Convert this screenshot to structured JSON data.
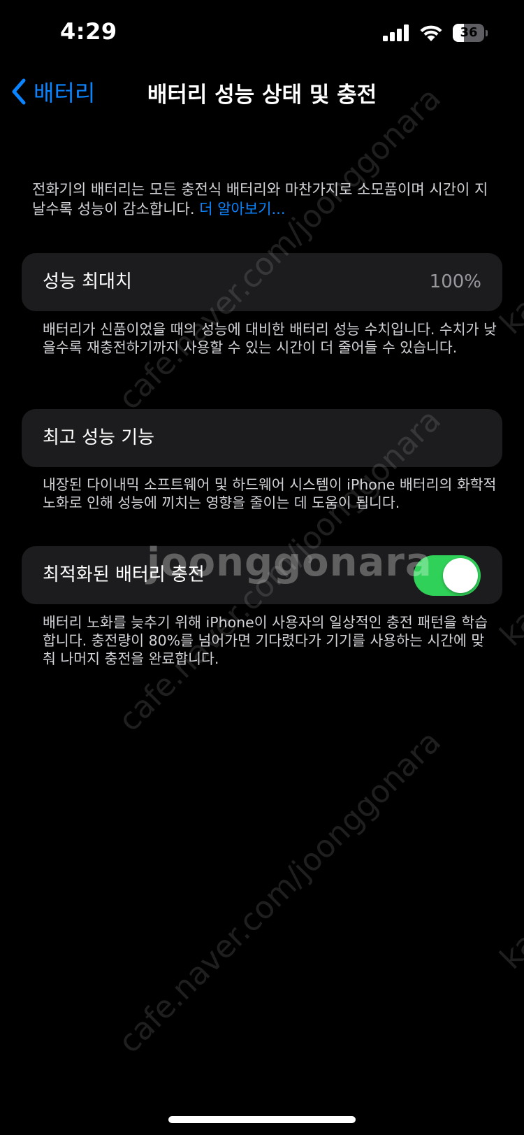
{
  "status_bar": {
    "time": "4:29",
    "battery_level": "36",
    "battery_fraction": 0.36,
    "icons": [
      "cellular-signal-icon",
      "wifi-icon",
      "battery-icon"
    ]
  },
  "nav": {
    "back_label": "배터리",
    "title": "배터리 성능 상태 및 충전"
  },
  "intro": {
    "text": "전화기의 배터리는 모든 충전식 배터리와 마찬가지로 소모품이며 시간이 지날수록 성능이 감소합니다. ",
    "link": "더 알아보기..."
  },
  "maximum_capacity": {
    "label": "성능 최대치",
    "value": "100%",
    "footer": "배터리가 신품이었을 때의 성능에 대비한 배터리 성능 수치입니다. 수치가 낮을수록 재충전하기까지 사용할 수 있는 시간이 더 줄어들 수 있습니다."
  },
  "peak_performance": {
    "label": "최고 성능 기능",
    "footer": "내장된 다이내믹 소프트웨어 및 하드웨어 시스템이 iPhone 배터리의 화학적 노화로 인해 성능에 끼치는 영향을 줄이는 데 도움이 됩니다."
  },
  "optimized_charging": {
    "label": "최적화된 배터리 충전",
    "enabled": true,
    "footer": "배터리 노화를 늦추기 위해 iPhone이 사용자의 일상적인 충전 패턴을 학습합니다. 충전량이 80%를 넘어가면 기다렸다가 기기를 사용하는 시간에 맞춰 나머지 충전을 완료합니다."
  },
  "watermark": {
    "text": "cafe.naver.com/joonggonara",
    "side_text": "ka",
    "logo": "joonggonara"
  },
  "colors": {
    "background": "#000000",
    "group_background": "#1c1c1e",
    "accent": "#0a84ff",
    "toggle_on": "#30d158",
    "secondary_text": "#98989d"
  }
}
